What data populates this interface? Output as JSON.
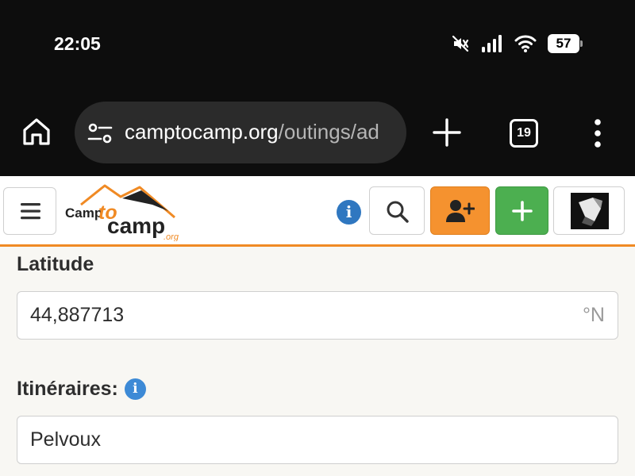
{
  "status_bar": {
    "time": "22:05",
    "icons": [
      "mute-icon",
      "signal-icon",
      "wifi-icon"
    ],
    "battery_level": "57"
  },
  "browser": {
    "url_domain": "camptocamp.org",
    "url_path": "/outings/ad",
    "tab_count": "19",
    "icons": [
      "home-icon",
      "site-settings-icon",
      "plus-icon",
      "more-vert-icon"
    ]
  },
  "site": {
    "logo_text_top": "Camp",
    "logo_text_to": "to",
    "logo_text_bottom": "camp",
    "logo_suffix": ".org",
    "colors": {
      "accent": "#f08a24",
      "info": "#2f77c0",
      "add": "#4caf50",
      "signup": "#f5922f"
    }
  },
  "form": {
    "latitude_label": "Latitude",
    "latitude_value": "44,887713",
    "latitude_unit": "°N",
    "itineraries_label": "Itinéraires:",
    "itineraries_value": "Pelvoux"
  }
}
